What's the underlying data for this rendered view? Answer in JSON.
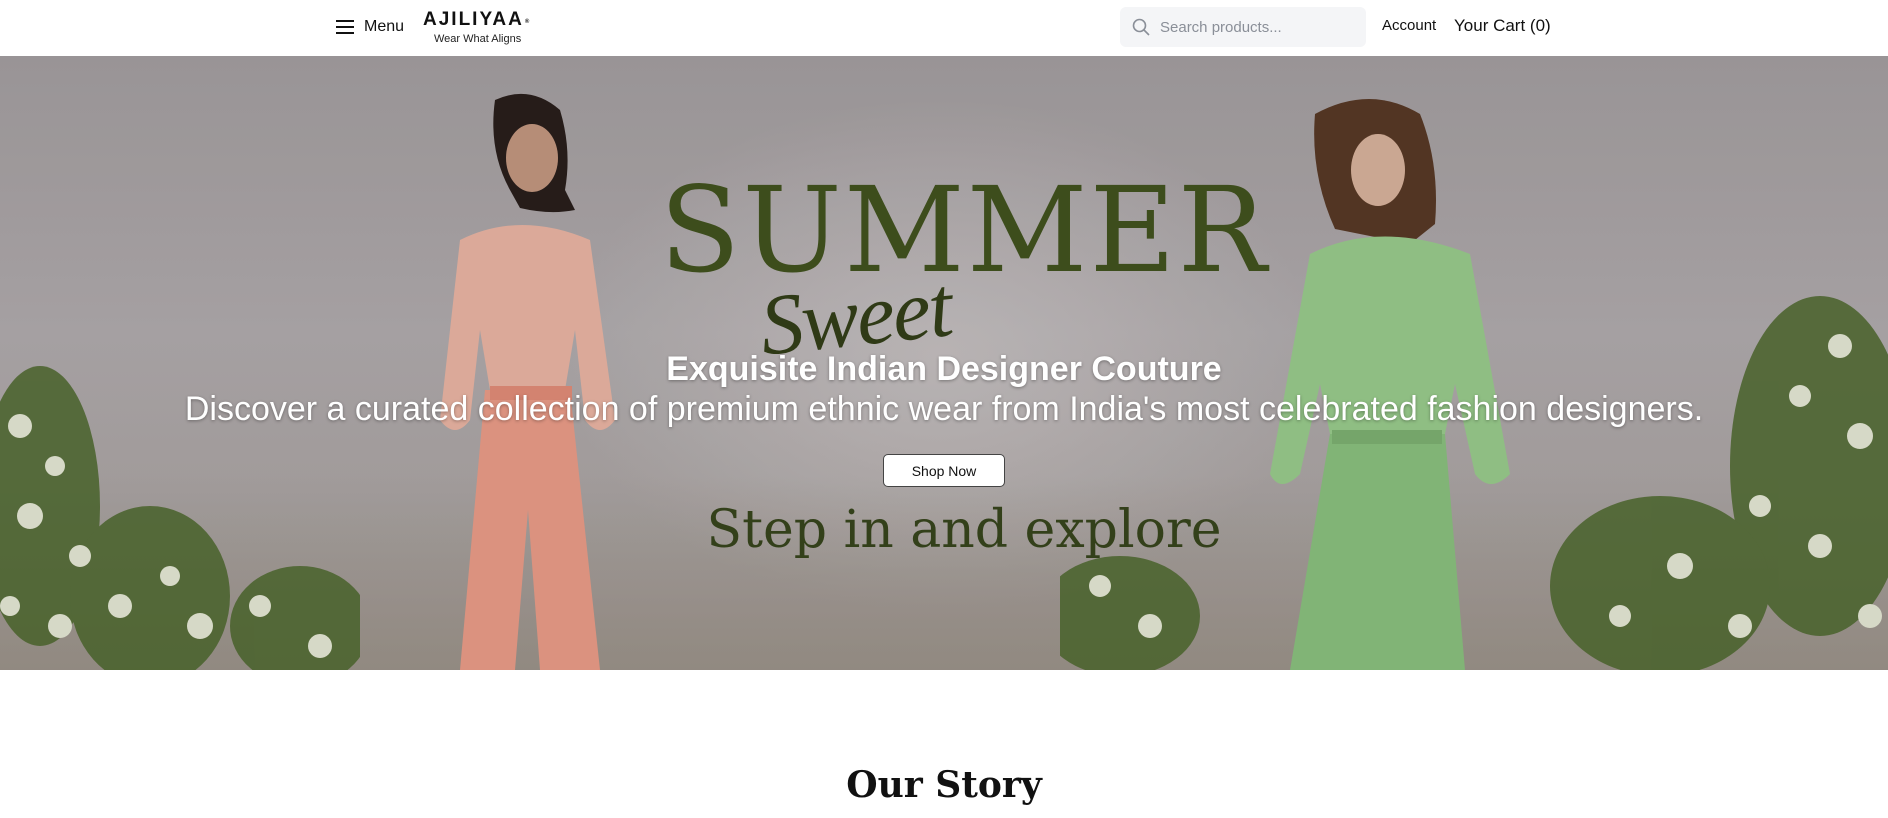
{
  "header": {
    "menu_label": "Menu",
    "logo_text": "AJILIYAA",
    "logo_mark": "®",
    "logo_tagline": "Wear What Aligns",
    "search_placeholder": "Search products...",
    "account_label": "Account",
    "cart_label": "Your Cart (0)"
  },
  "hero": {
    "banner_headline": "SUMMER",
    "banner_script": "Sweet",
    "title": "Exquisite Indian Designer Couture",
    "subtitle": "Discover a curated collection of premium ethnic wear from India's most celebrated fashion designers.",
    "cta_label": "Shop Now",
    "banner_tagline": "Step in and explore"
  },
  "story": {
    "heading": "Our Story"
  },
  "icons": {
    "menu": "hamburger-icon",
    "search": "search-icon"
  },
  "colors": {
    "banner_text": "#3d4d1c",
    "hero_text": "#ffffff",
    "search_bg": "#f4f5f7"
  }
}
